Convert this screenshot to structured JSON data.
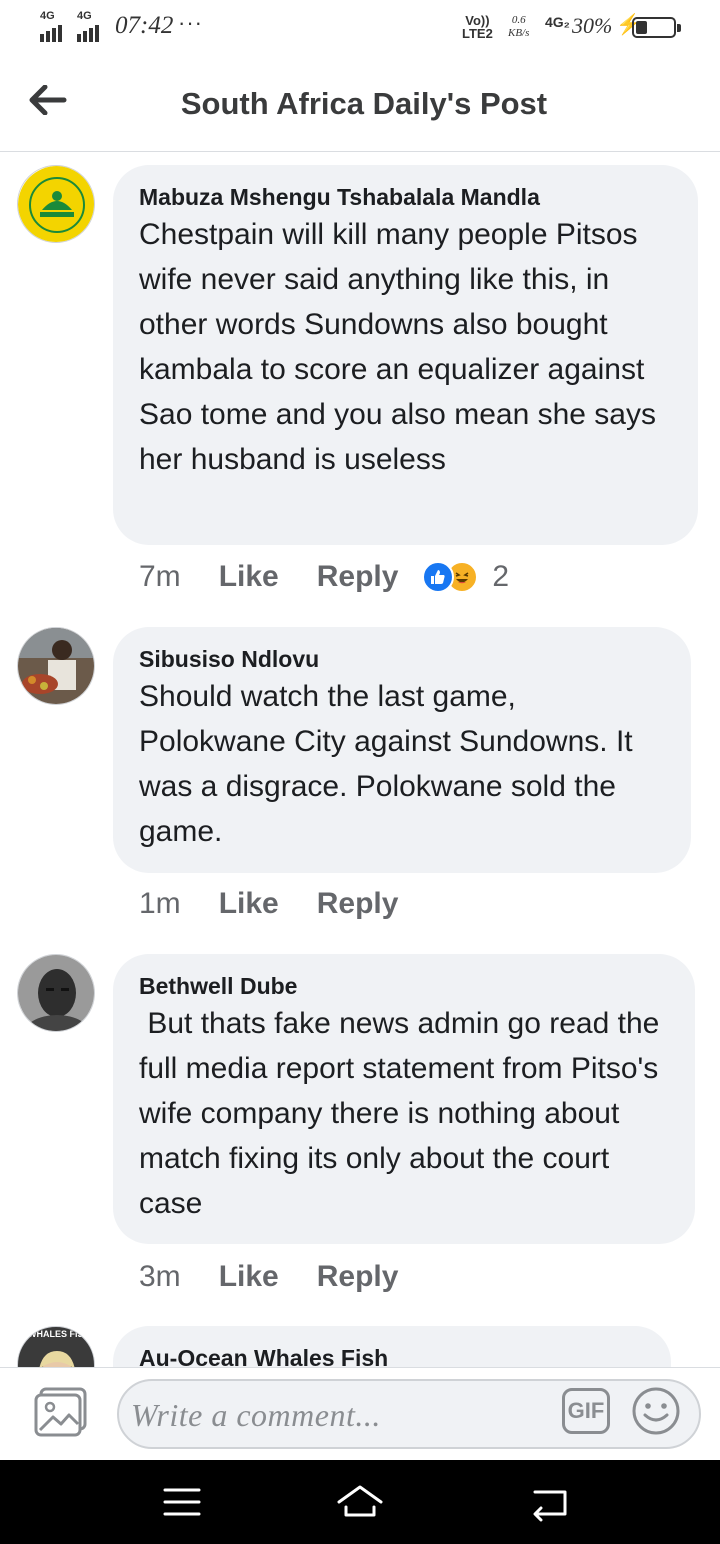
{
  "status_bar": {
    "signal1_label": "4G",
    "signal2_label": "4G",
    "time": "07:42",
    "dots": "···",
    "volte_line1": "Vo))",
    "volte_line2": "LTE2",
    "speed_value": "0.6",
    "speed_unit": "KB/s",
    "network": "4G₂",
    "battery_percent": "30%",
    "battery_level": 0.3
  },
  "header": {
    "title": "South Africa Daily's Post",
    "back_icon": "arrow-left-icon"
  },
  "comments": [
    {
      "author": "Mabuza Mshengu Tshabalala Mandla",
      "text": "Chestpain will kill many people Pitsos wife never said anything like this, in other words Sundowns also bought kambala to score an equalizer against Sao tome and you also mean she says her husband is useless",
      "time": "7m",
      "like_label": "Like",
      "reply_label": "Reply",
      "reactions": [
        "like-icon",
        "haha-icon"
      ],
      "reaction_count": "2"
    },
    {
      "author": "Sibusiso Ndlovu",
      "text": "Should watch the last game, Polokwane City against Sundowns. It was a disgrace. Polokwane sold the game.",
      "time": "1m",
      "like_label": "Like",
      "reply_label": "Reply"
    },
    {
      "author": "Bethwell Dube",
      "text": " But thats fake news admin go read the full media report statement from Pitso's wife company there is nothing about match fixing its only about the court case",
      "time": "3m",
      "like_label": "Like",
      "reply_label": "Reply"
    },
    {
      "author": "Au-Ocean Whales Fish",
      "avatar_text": "EWHALES FISH"
    }
  ],
  "composer": {
    "placeholder": "Write a comment...",
    "gif_label": "GIF",
    "photo_icon": "photo-icon",
    "emoji_icon": "emoji-icon"
  },
  "navbar": {
    "icons": [
      "menu-icon",
      "home-icon",
      "back-icon"
    ]
  },
  "colors": {
    "accent": "#1877f2",
    "bubble": "#f0f2f5",
    "secondary_text": "#65676b"
  }
}
